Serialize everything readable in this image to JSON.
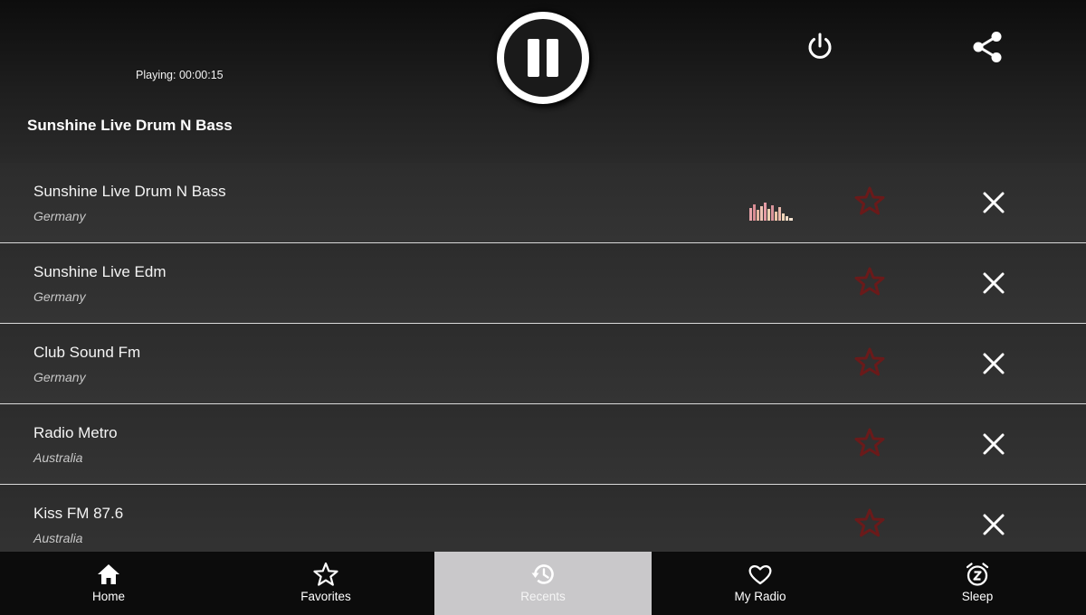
{
  "player": {
    "playing_label": "Playing: 00:00:15",
    "now_playing_title": "Sunshine Live Drum N Bass",
    "state": "playing"
  },
  "header_icons": [
    "pause-icon",
    "power-icon",
    "share-icon"
  ],
  "stations": [
    {
      "name": "Sunshine Live Drum N Bass",
      "country": "Germany",
      "now_playing": true
    },
    {
      "name": "Sunshine Live Edm",
      "country": "Germany",
      "now_playing": false
    },
    {
      "name": "Club Sound Fm",
      "country": "Germany",
      "now_playing": false
    },
    {
      "name": "Radio Metro",
      "country": "Australia",
      "now_playing": false
    },
    {
      "name": "Kiss FM 87.6",
      "country": "Australia",
      "now_playing": false
    }
  ],
  "row_icons": {
    "favorite": "star-icon",
    "remove": "close-icon",
    "equalizer": "equalizer-icon"
  },
  "nav": {
    "items": [
      {
        "label": "Home",
        "icon": "home-icon",
        "active": false
      },
      {
        "label": "Favorites",
        "icon": "star-outline-icon",
        "active": false
      },
      {
        "label": "Recents",
        "icon": "history-icon",
        "active": true
      },
      {
        "label": "My Radio",
        "icon": "heart-icon",
        "active": false
      },
      {
        "label": "Sleep",
        "icon": "alarm-sleep-icon",
        "active": false
      }
    ]
  },
  "colors": {
    "header_bg": "#111111",
    "list_bg": "#2d2d2d",
    "divider": "#d9d9d9",
    "favorite_star": "#6a1a1a",
    "nav_bg": "#0c0c0c",
    "nav_active_bg": "#c9c8ca"
  }
}
